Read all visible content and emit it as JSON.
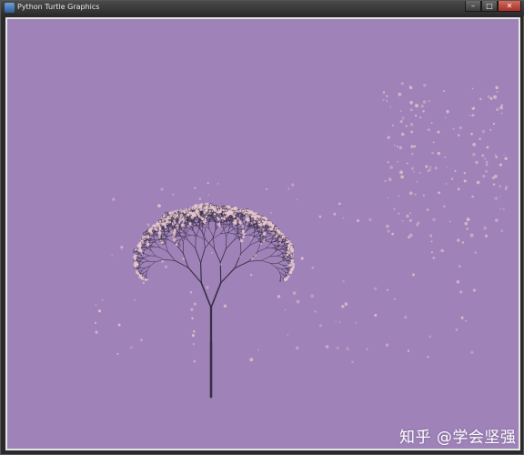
{
  "window": {
    "title": "Python Turtle Graphics",
    "minimize_symbol": "–",
    "maximize_symbol": "□",
    "close_symbol": "✕"
  },
  "canvas": {
    "background_color": "#9e82b8",
    "branch_color": "#3a2f45",
    "blossom_color": "#e9c9cf"
  },
  "watermark": {
    "text": "知乎 @学会坚强"
  }
}
